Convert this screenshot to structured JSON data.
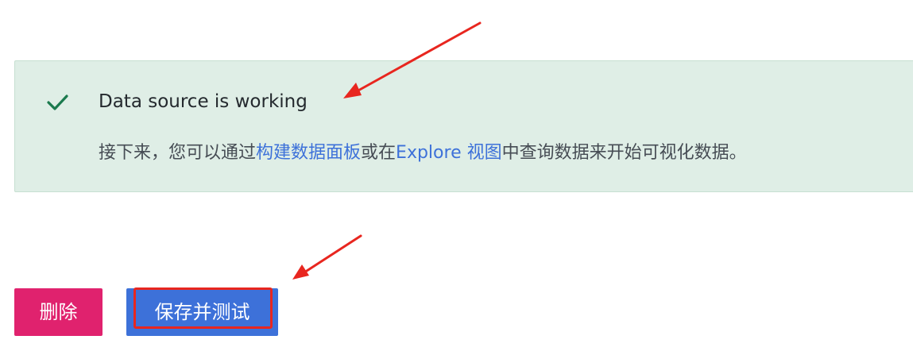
{
  "alert": {
    "icon": "checkmark-icon",
    "title": "Data source is working",
    "body_prefix": "接下来，您可以通过",
    "link_dashboard": "构建数据面板",
    "body_middle": "或在",
    "link_explore": "Explore 视图",
    "body_suffix": "中查询数据来开始可视化数据。"
  },
  "buttons": {
    "delete_label": "删除",
    "save_test_label": "保存并测试"
  },
  "colors": {
    "success_bg": "#dfeee6",
    "success_icon": "#1b7a4e",
    "link": "#3d71d9",
    "delete_button": "#e0226e",
    "primary_button": "#3d71d9",
    "annotation": "#e8261f"
  }
}
